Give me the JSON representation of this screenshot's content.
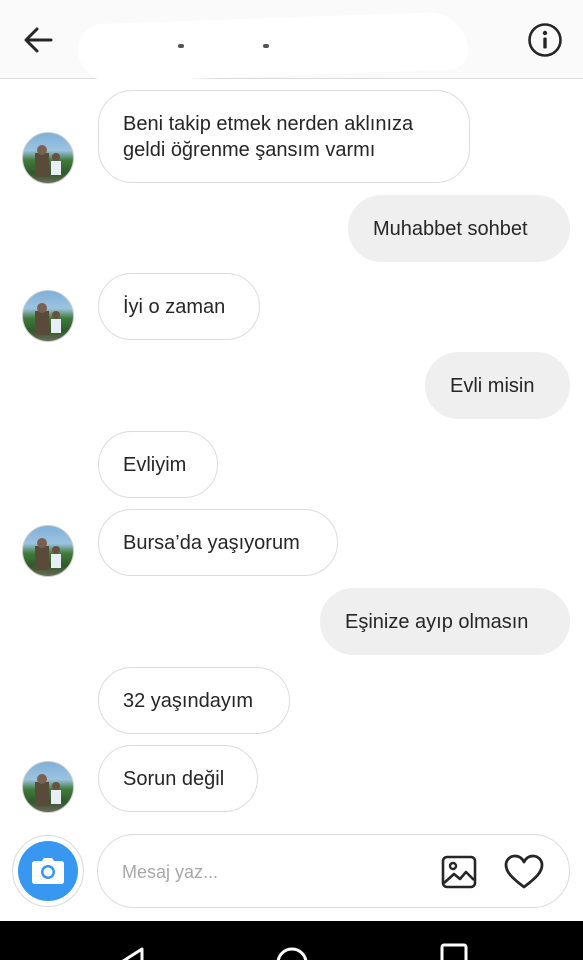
{
  "header": {
    "title": "",
    "back_icon": "arrow-left-icon",
    "info_icon": "info-circle-icon"
  },
  "messages": [
    {
      "side": "received",
      "text": "Beni takip etmek nerden aklınıza geldi öğrenme şansım varmı",
      "avatar": true
    },
    {
      "side": "sent",
      "text": "Muhabbet sohbet"
    },
    {
      "side": "received",
      "text": "İyi o zaman",
      "avatar": true
    },
    {
      "side": "sent",
      "text": "Evli misin"
    },
    {
      "side": "received",
      "text": "Evliyim",
      "avatar": false
    },
    {
      "side": "received",
      "text": "Bursa’da yaşıyorum",
      "avatar": true
    },
    {
      "side": "sent",
      "text": "Eşinize ayıp olmasın"
    },
    {
      "side": "received",
      "text": "32 yaşındayım",
      "avatar": false
    },
    {
      "side": "received",
      "text": "Sorun değil",
      "avatar": true
    }
  ],
  "composer": {
    "placeholder": "Mesaj yaz...",
    "camera_icon": "camera-icon",
    "gallery_icon": "image-gallery-icon",
    "heart_icon": "heart-icon"
  },
  "colors": {
    "accent": "#3897f0",
    "sent_bubble": "#efefef",
    "bubble_border": "#dcdcdc",
    "text": "#262626",
    "placeholder": "#a8a8a8"
  },
  "navbar": {
    "back_icon": "nav-back-triangle-icon",
    "home_icon": "nav-home-circle-icon",
    "recents_icon": "nav-recents-square-icon"
  }
}
